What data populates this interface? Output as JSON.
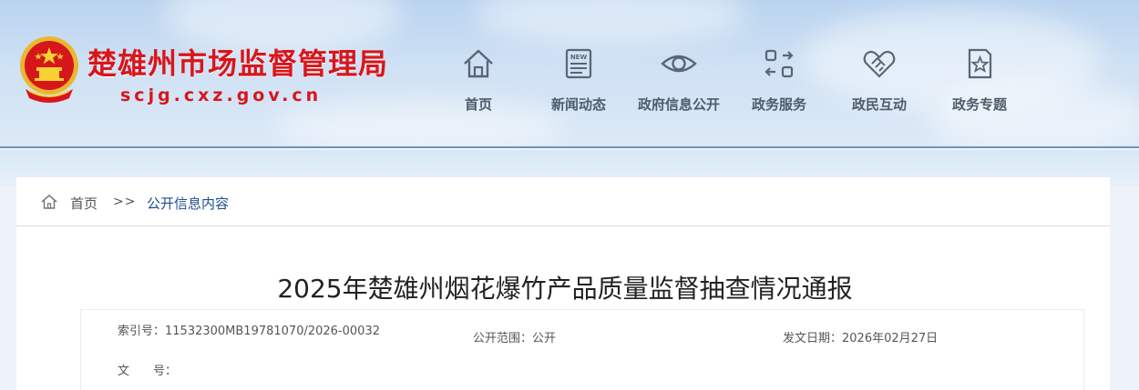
{
  "header": {
    "site_title": "楚雄州市场监督管理局",
    "site_url": "scjg.cxz.gov.cn"
  },
  "nav": [
    {
      "label": "首页",
      "icon": "home-icon"
    },
    {
      "label": "新闻动态",
      "icon": "news-icon"
    },
    {
      "label": "政府信息公开",
      "icon": "eye-icon"
    },
    {
      "label": "政务服务",
      "icon": "services-icon"
    },
    {
      "label": "政民互动",
      "icon": "handshake-icon"
    },
    {
      "label": "政务专题",
      "icon": "star-document-icon"
    }
  ],
  "breadcrumb": {
    "home": "首页",
    "separator": ">>",
    "current": "公开信息内容"
  },
  "article": {
    "title": "2025年楚雄州烟花爆竹产品质量监督抽查情况通报"
  },
  "meta": {
    "index_no": "索引号：11532300MB19781070/2026-00032",
    "scope": "公开范围：公开",
    "date": "发文日期：2026年02月27日",
    "doc_no": "文　　号："
  },
  "colors": {
    "title_red": "#d7161b",
    "nav_gray": "#4d5b6a",
    "link_blue": "#1c4f8f"
  }
}
